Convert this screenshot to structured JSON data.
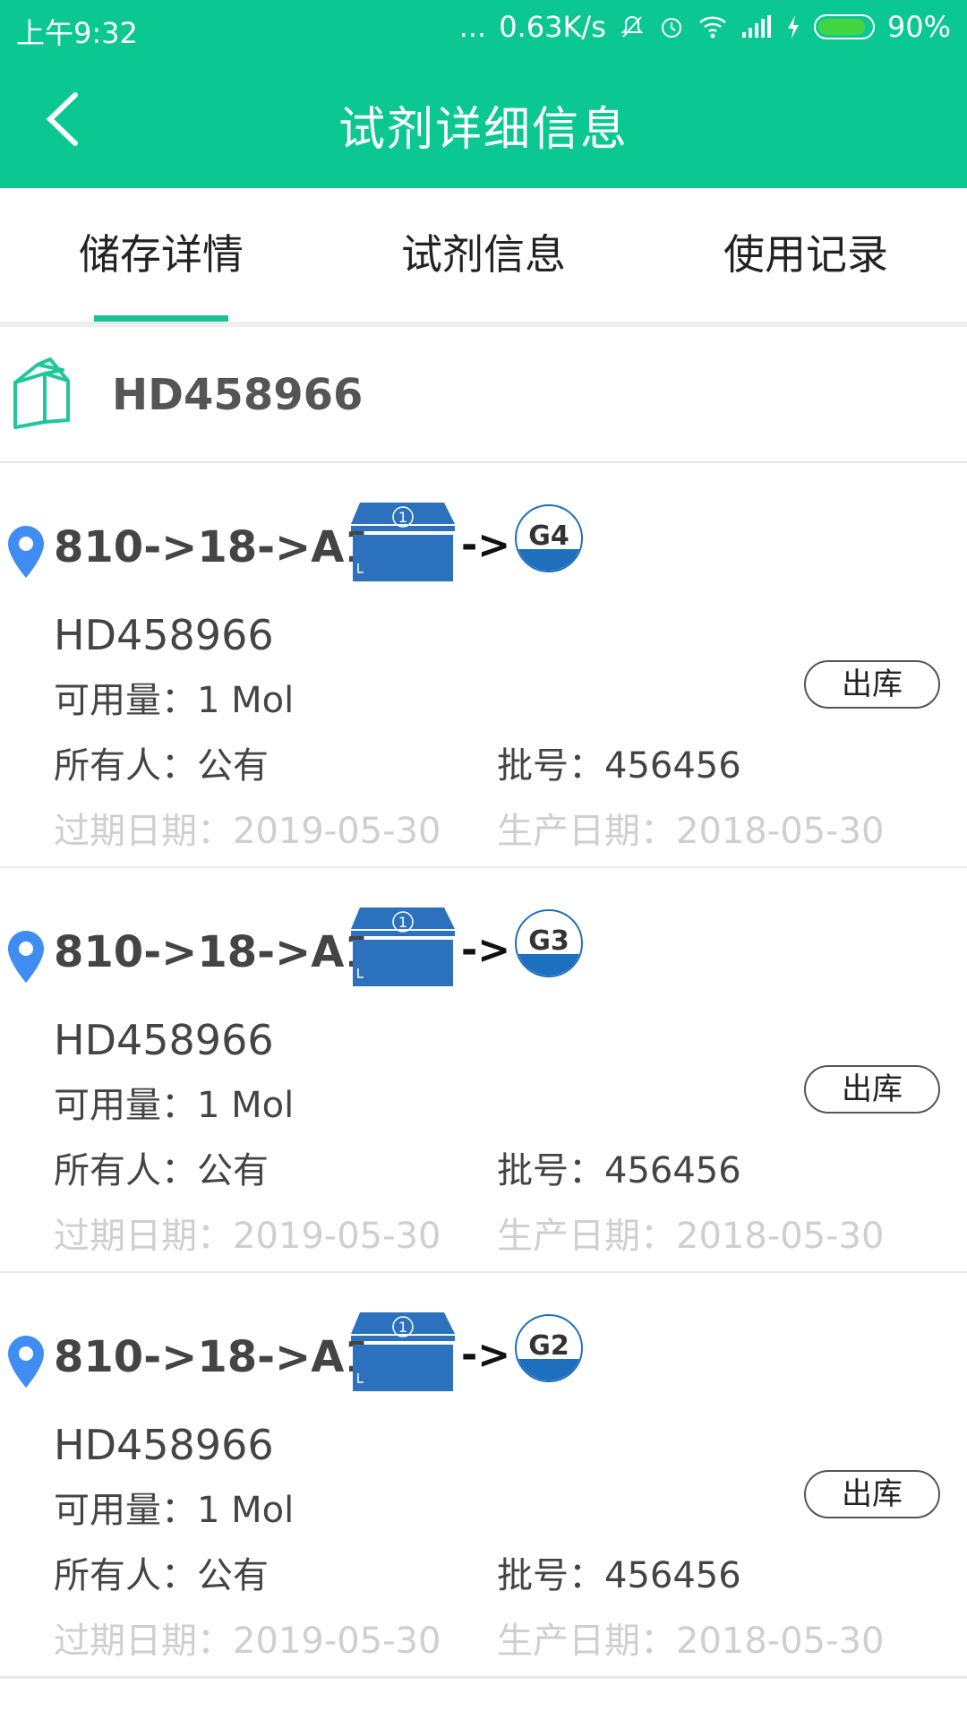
{
  "status_bar": {
    "time": "上午9:32",
    "dots": "...",
    "speed": "0.63K/s",
    "battery": "90%",
    "icons": [
      "mute-bell-icon",
      "alarm-icon",
      "wifi-icon",
      "signal-icon",
      "charging-icon",
      "battery-icon"
    ]
  },
  "app_bar": {
    "title": "试剂详细信息",
    "back_icon": "chevron-left-icon"
  },
  "tabs": [
    {
      "label": "储存详情",
      "active": true
    },
    {
      "label": "试剂信息",
      "active": false
    },
    {
      "label": "使用记录",
      "active": false
    }
  ],
  "header": {
    "code": "HD458966",
    "icon": "reagent-box-icon"
  },
  "cards": [
    {
      "path": "810->18->A1->",
      "arrow": "->",
      "slot": "G4",
      "code": "HD458966",
      "quantity": "可用量：1 Mol",
      "action": "出库",
      "owner": "所有人：公有",
      "batch": "批号：456456",
      "expire": "过期日期：2019-05-30",
      "produced": "生产日期：2018-05-30"
    },
    {
      "path": "810->18->A1->",
      "arrow": "->",
      "slot": "G3",
      "code": "HD458966",
      "quantity": "可用量：1 Mol",
      "action": "出库",
      "owner": "所有人：公有",
      "batch": "批号：456456",
      "expire": "过期日期：2019-05-30",
      "produced": "生产日期：2018-05-30"
    },
    {
      "path": "810->18->A1->",
      "arrow": "->",
      "slot": "G2",
      "code": "HD458966",
      "quantity": "可用量：1 Mol",
      "action": "出库",
      "owner": "所有人：公有",
      "batch": "批号：456456",
      "expire": "过期日期：2019-05-30",
      "produced": "生产日期：2018-05-30"
    }
  ],
  "colors": {
    "primary": "#0bc792",
    "accent_tab": "#17c393",
    "cabinet_blue": "#2b71bd",
    "pin_blue": "#3f8cf3",
    "muted": "#cfcfcf"
  }
}
